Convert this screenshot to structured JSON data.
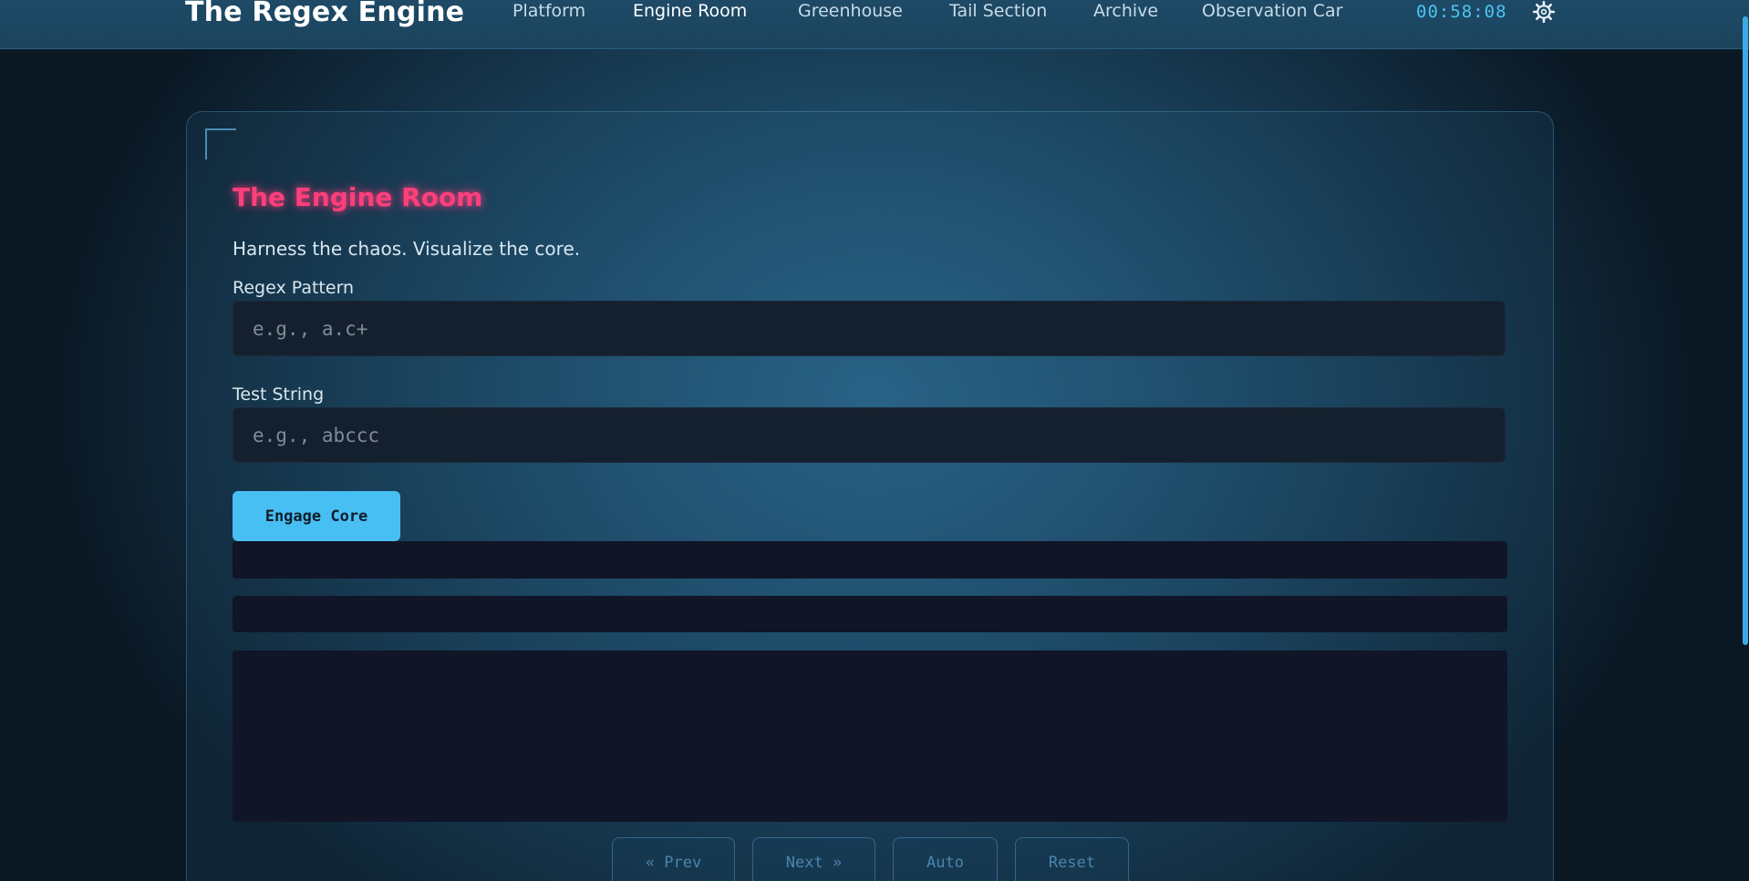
{
  "header": {
    "brand": "The Regex Engine",
    "nav": [
      {
        "label": "Platform",
        "active": false
      },
      {
        "label": "Engine Room",
        "active": true
      },
      {
        "label": "Greenhouse",
        "active": false
      },
      {
        "label": "Tail Section",
        "active": false
      },
      {
        "label": "Archive",
        "active": false
      },
      {
        "label": "Observation Car",
        "active": false
      }
    ],
    "clock": "00:58:08",
    "settings_icon": "gear-icon"
  },
  "panel": {
    "title": "The Engine Room",
    "subtitle": "Harness the chaos. Visualize the core.",
    "pattern": {
      "label": "Regex Pattern",
      "placeholder": "e.g., a.c+",
      "value": ""
    },
    "test_string": {
      "label": "Test String",
      "placeholder": "e.g., abccc",
      "value": ""
    },
    "engage_label": "Engage Core",
    "controls": {
      "prev": "« Prev",
      "next": "Next »",
      "auto": "Auto",
      "reset": "Reset"
    }
  },
  "colors": {
    "accent": "#48bff2",
    "title": "#ff3f7c",
    "clock": "#4cc4f2"
  }
}
